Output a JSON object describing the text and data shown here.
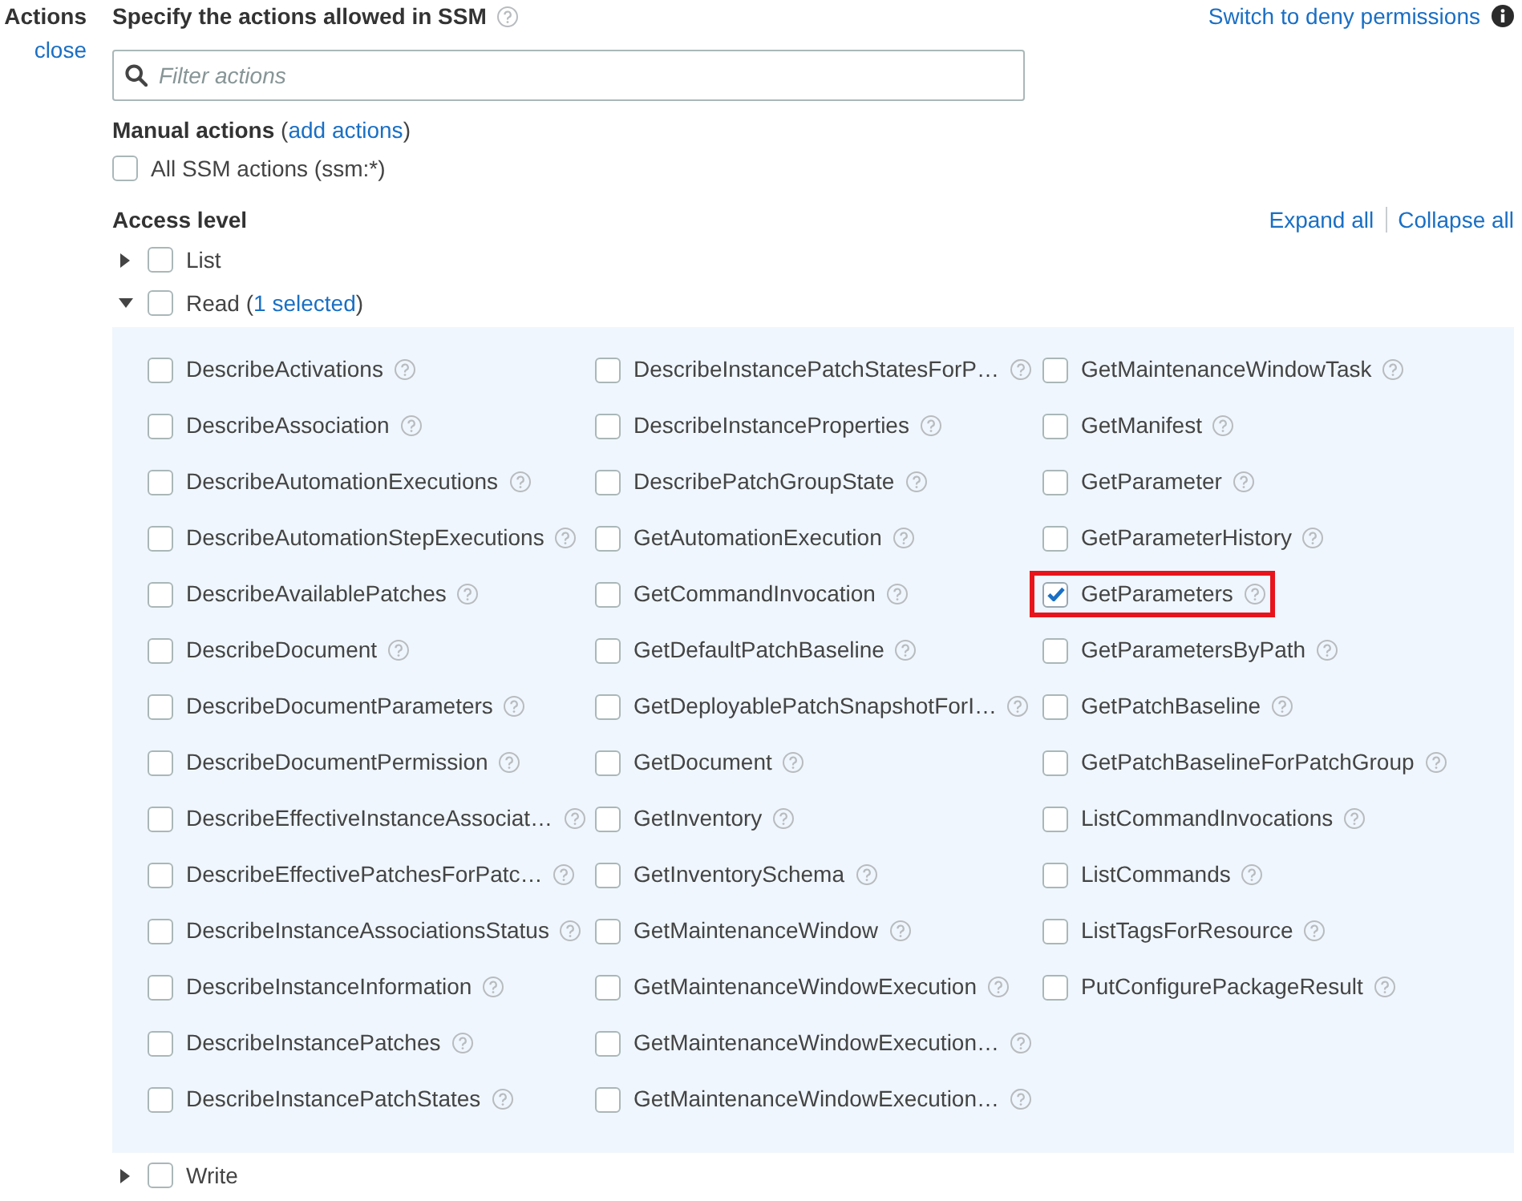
{
  "sidebar": {
    "title": "Actions",
    "close_link": "close"
  },
  "header": {
    "title": "Specify the actions allowed in SSM",
    "switch_link": "Switch to deny permissions"
  },
  "filter": {
    "placeholder": "Filter actions"
  },
  "manual_actions": {
    "title": "Manual actions",
    "link_prefix": "(",
    "link": "add actions",
    "link_suffix": ")"
  },
  "all_actions": {
    "label": "All SSM actions (ssm:*)",
    "checked": false
  },
  "access_level": {
    "title": "Access level",
    "expand_link": "Expand all",
    "collapse_link": "Collapse all",
    "groups": [
      {
        "label": "List",
        "expanded": false,
        "checked": false
      },
      {
        "label": "Read",
        "count_prefix": "(",
        "count": "1 selected",
        "count_suffix": ")",
        "expanded": true,
        "checked": false,
        "columns": [
          {
            "items": [
              {
                "name": "DescribeActivations",
                "checked": false,
                "highlighted": false
              },
              {
                "name": "DescribeAssociation",
                "checked": false,
                "highlighted": false
              },
              {
                "name": "DescribeAutomationExecutions",
                "checked": false,
                "highlighted": false
              },
              {
                "name": "DescribeAutomationStepExecutions",
                "checked": false,
                "highlighted": false
              },
              {
                "name": "DescribeAvailablePatches",
                "checked": false,
                "highlighted": false
              },
              {
                "name": "DescribeDocument",
                "checked": false,
                "highlighted": false
              },
              {
                "name": "DescribeDocumentParameters",
                "checked": false,
                "highlighted": false
              },
              {
                "name": "DescribeDocumentPermission",
                "checked": false,
                "highlighted": false
              },
              {
                "name": "DescribeEffectiveInstanceAssociat…",
                "checked": false,
                "highlighted": false
              },
              {
                "name": "DescribeEffectivePatchesForPatc…",
                "checked": false,
                "highlighted": false
              },
              {
                "name": "DescribeInstanceAssociationsStatus",
                "checked": false,
                "highlighted": false
              },
              {
                "name": "DescribeInstanceInformation",
                "checked": false,
                "highlighted": false
              },
              {
                "name": "DescribeInstancePatches",
                "checked": false,
                "highlighted": false
              },
              {
                "name": "DescribeInstancePatchStates",
                "checked": false,
                "highlighted": false
              }
            ]
          },
          {
            "items": [
              {
                "name": "DescribeInstancePatchStatesForP…",
                "checked": false,
                "highlighted": false
              },
              {
                "name": "DescribeInstanceProperties",
                "checked": false,
                "highlighted": false
              },
              {
                "name": "DescribePatchGroupState",
                "checked": false,
                "highlighted": false
              },
              {
                "name": "GetAutomationExecution",
                "checked": false,
                "highlighted": false
              },
              {
                "name": "GetCommandInvocation",
                "checked": false,
                "highlighted": false
              },
              {
                "name": "GetDefaultPatchBaseline",
                "checked": false,
                "highlighted": false
              },
              {
                "name": "GetDeployablePatchSnapshotForI…",
                "checked": false,
                "highlighted": false
              },
              {
                "name": "GetDocument",
                "checked": false,
                "highlighted": false
              },
              {
                "name": "GetInventory",
                "checked": false,
                "highlighted": false
              },
              {
                "name": "GetInventorySchema",
                "checked": false,
                "highlighted": false
              },
              {
                "name": "GetMaintenanceWindow",
                "checked": false,
                "highlighted": false
              },
              {
                "name": "GetMaintenanceWindowExecution",
                "checked": false,
                "highlighted": false
              },
              {
                "name": "GetMaintenanceWindowExecution…",
                "checked": false,
                "highlighted": false
              },
              {
                "name": "GetMaintenanceWindowExecution…",
                "checked": false,
                "highlighted": false
              }
            ]
          },
          {
            "items": [
              {
                "name": "GetMaintenanceWindowTask",
                "checked": false,
                "highlighted": false
              },
              {
                "name": "GetManifest",
                "checked": false,
                "highlighted": false
              },
              {
                "name": "GetParameter",
                "checked": false,
                "highlighted": false
              },
              {
                "name": "GetParameterHistory",
                "checked": false,
                "highlighted": false
              },
              {
                "name": "GetParameters",
                "checked": true,
                "highlighted": true
              },
              {
                "name": "GetParametersByPath",
                "checked": false,
                "highlighted": false
              },
              {
                "name": "GetPatchBaseline",
                "checked": false,
                "highlighted": false
              },
              {
                "name": "GetPatchBaselineForPatchGroup",
                "checked": false,
                "highlighted": false
              },
              {
                "name": "ListCommandInvocations",
                "checked": false,
                "highlighted": false
              },
              {
                "name": "ListCommands",
                "checked": false,
                "highlighted": false
              },
              {
                "name": "ListTagsForResource",
                "checked": false,
                "highlighted": false
              },
              {
                "name": "PutConfigurePackageResult",
                "checked": false,
                "highlighted": false
              }
            ]
          }
        ]
      },
      {
        "label": "Write",
        "expanded": false,
        "checked": false
      }
    ]
  }
}
